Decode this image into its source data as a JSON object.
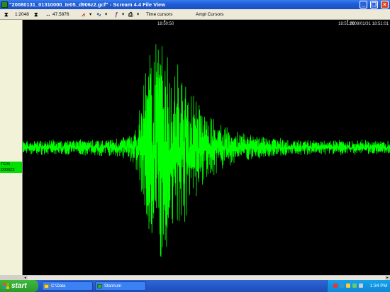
{
  "window": {
    "title": "\"20080131_01310000_te05_d906z2.gcf\" - Scream 4.4 File View",
    "controls": [
      "minimize-icon",
      "restore-icon",
      "close-icon"
    ]
  },
  "toolbar": {
    "zoom_ratio": "1:2048",
    "time_span": "47.5876",
    "time_cursors_label": "Time cursors",
    "ampl_cursors_label": "Ampl Cursors"
  },
  "plot": {
    "background": "#000000",
    "trace_color": "#00ff00",
    "time_ticks": [
      "18:50:50",
      "18:51:00"
    ],
    "date_time": "2008/01/31 18:51:01",
    "channel_label": [
      "TE05",
      "D906Z2"
    ]
  },
  "taskbar": {
    "start_label": "start",
    "buttons": [
      {
        "label": "C:\\Data",
        "icon": "folder-icon"
      },
      {
        "label": "Stannum",
        "icon": "app-icon"
      }
    ],
    "clock": "1:34 PM"
  },
  "chart_data": {
    "type": "line",
    "title": "",
    "xlabel": "",
    "ylabel": "",
    "x_tick_labels": [
      "18:50:50",
      "18:51:00"
    ],
    "series": [
      {
        "label": "TE05 D906Z2",
        "envelope_description": "seismic trace with event",
        "relative_amplitude_envelope": [
          0.06,
          0.06,
          0.07,
          0.06,
          0.07,
          0.06,
          0.07,
          0.06,
          0.08,
          0.07,
          0.08,
          0.07,
          0.08,
          0.09,
          0.12,
          0.2,
          0.45,
          0.95,
          1.0,
          0.9,
          0.8,
          0.7,
          0.6,
          0.45,
          0.35,
          0.28,
          0.22,
          0.18,
          0.15,
          0.13,
          0.12,
          0.1,
          0.1,
          0.09,
          0.08,
          0.08,
          0.07,
          0.07,
          0.07,
          0.06,
          0.07,
          0.06,
          0.07,
          0.06,
          0.06,
          0.07,
          0.06,
          0.06,
          0.06,
          0.06
        ]
      }
    ]
  }
}
